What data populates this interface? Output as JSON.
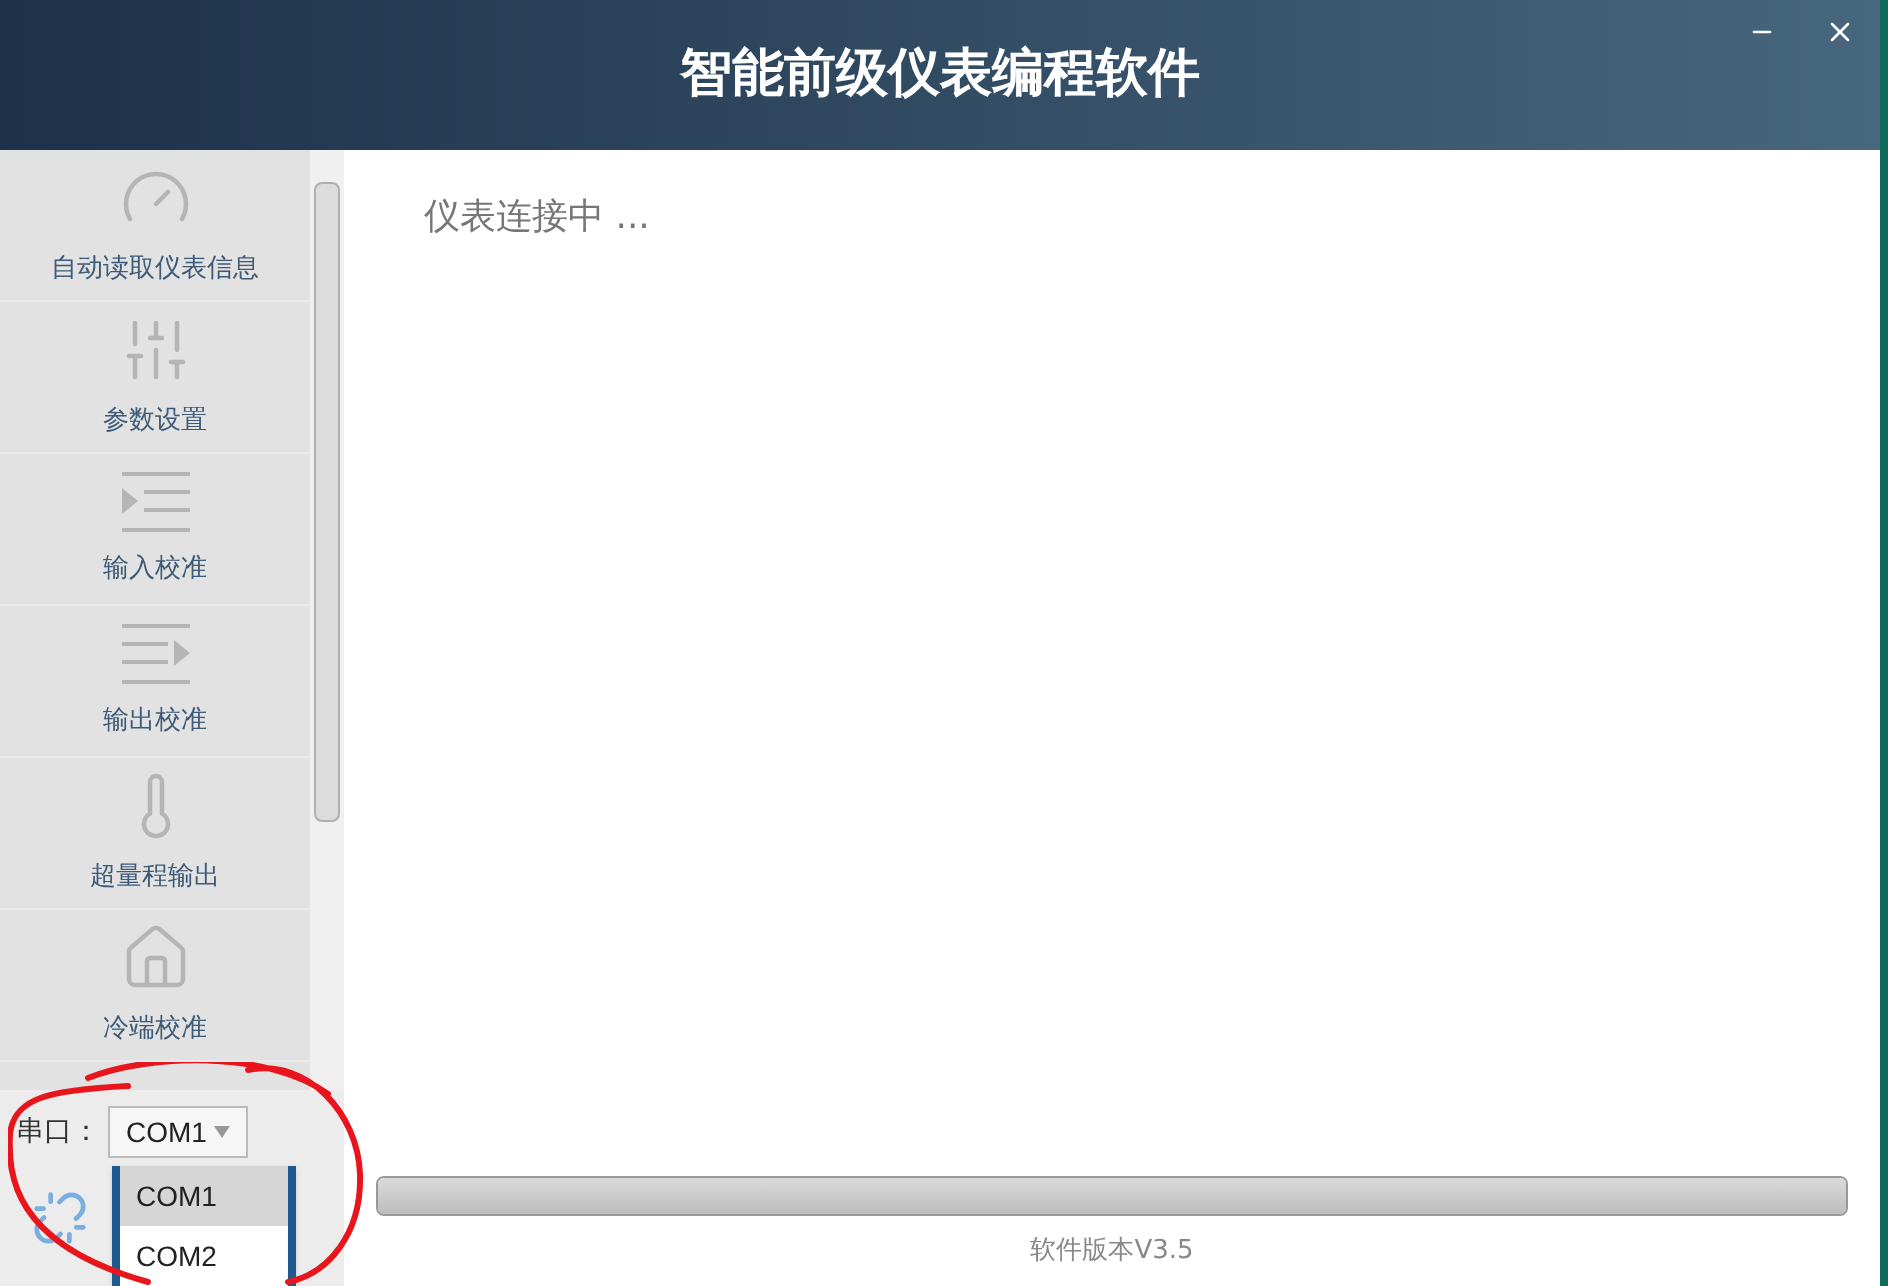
{
  "window": {
    "title": "智能前级仪表编程软件"
  },
  "sidebar": {
    "items": [
      {
        "kind": "gauge",
        "label": "自动读取仪表信息"
      },
      {
        "kind": "sliders",
        "label": "参数设置"
      },
      {
        "kind": "input",
        "label": "输入校准"
      },
      {
        "kind": "output",
        "label": "输出校准"
      },
      {
        "kind": "thermometer",
        "label": "超量程输出"
      },
      {
        "kind": "house",
        "label": "冷端校准"
      }
    ]
  },
  "serial_port": {
    "label": "串口：",
    "value": "COM1",
    "options": [
      {
        "label": "COM1",
        "selected": true
      },
      {
        "label": "COM2",
        "selected": false
      }
    ]
  },
  "main": {
    "status": "仪表连接中 ..."
  },
  "progress": {
    "level": 1
  },
  "footer": {
    "version": "软件版本V3.5"
  }
}
